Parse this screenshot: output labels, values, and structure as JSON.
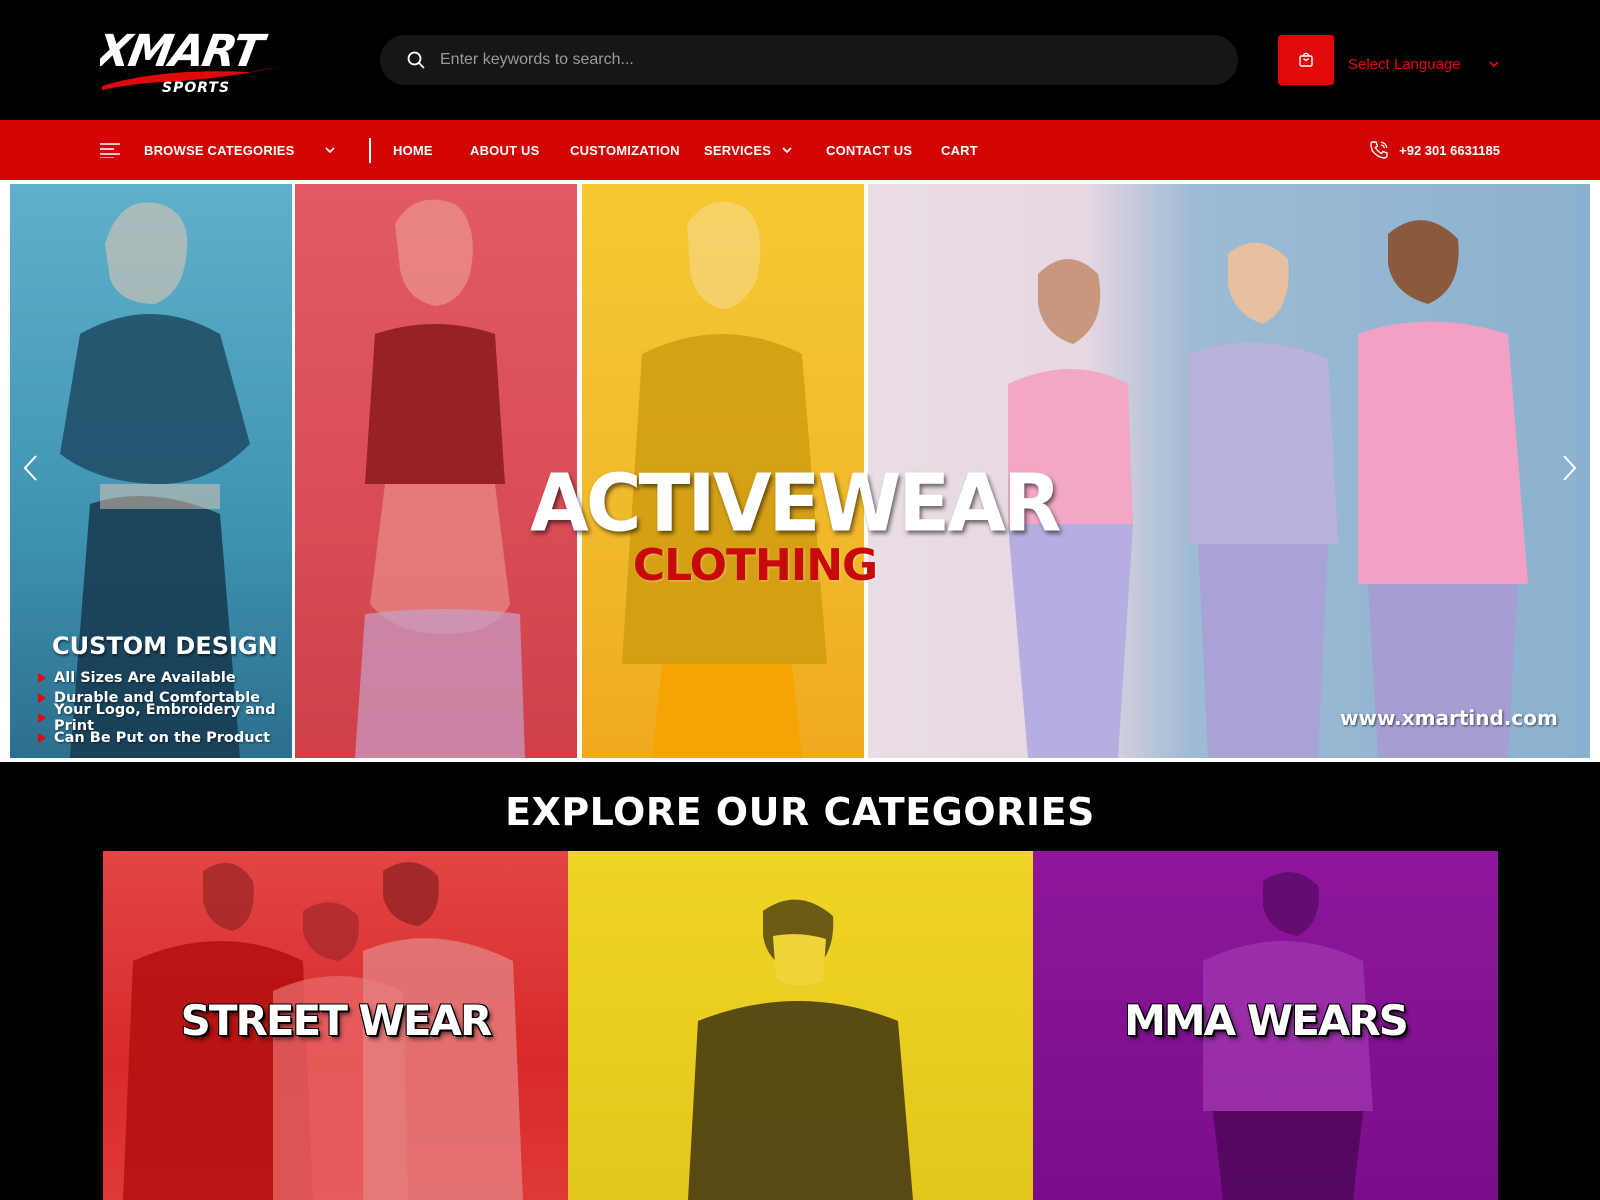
{
  "brand": {
    "name": "XMART",
    "tagline": "SPORTS",
    "accent": "#d20404"
  },
  "search": {
    "placeholder": "Enter keywords to search..."
  },
  "language": {
    "selected": "Select Language"
  },
  "nav": {
    "browse_label": "BROWSE CATEGORIES",
    "items": [
      "HOME",
      "ABOUT US",
      "CUSTOMIZATION",
      "SERVICES",
      "CONTACT US",
      "CART"
    ],
    "phone": "+92 301 6631185"
  },
  "hero": {
    "title": "ACTIVEWEAR",
    "subtitle": "CLOTHING",
    "custom_design": {
      "title": "CUSTOM DESIGN",
      "points": [
        "All Sizes Are Available",
        "Durable and Comfortable",
        "Your Logo, Embroidery and Print",
        "Can Be Put on the Product"
      ]
    },
    "url": "www.xmartind.com"
  },
  "categories": {
    "heading": "EXPLORE OUR CATEGORIES",
    "items": [
      {
        "label": "STREET WEAR",
        "color": "#d92a2a"
      },
      {
        "label": "",
        "color": "#e3c61c"
      },
      {
        "label": "MMA WEARS",
        "color": "#7a0e8a"
      }
    ]
  }
}
